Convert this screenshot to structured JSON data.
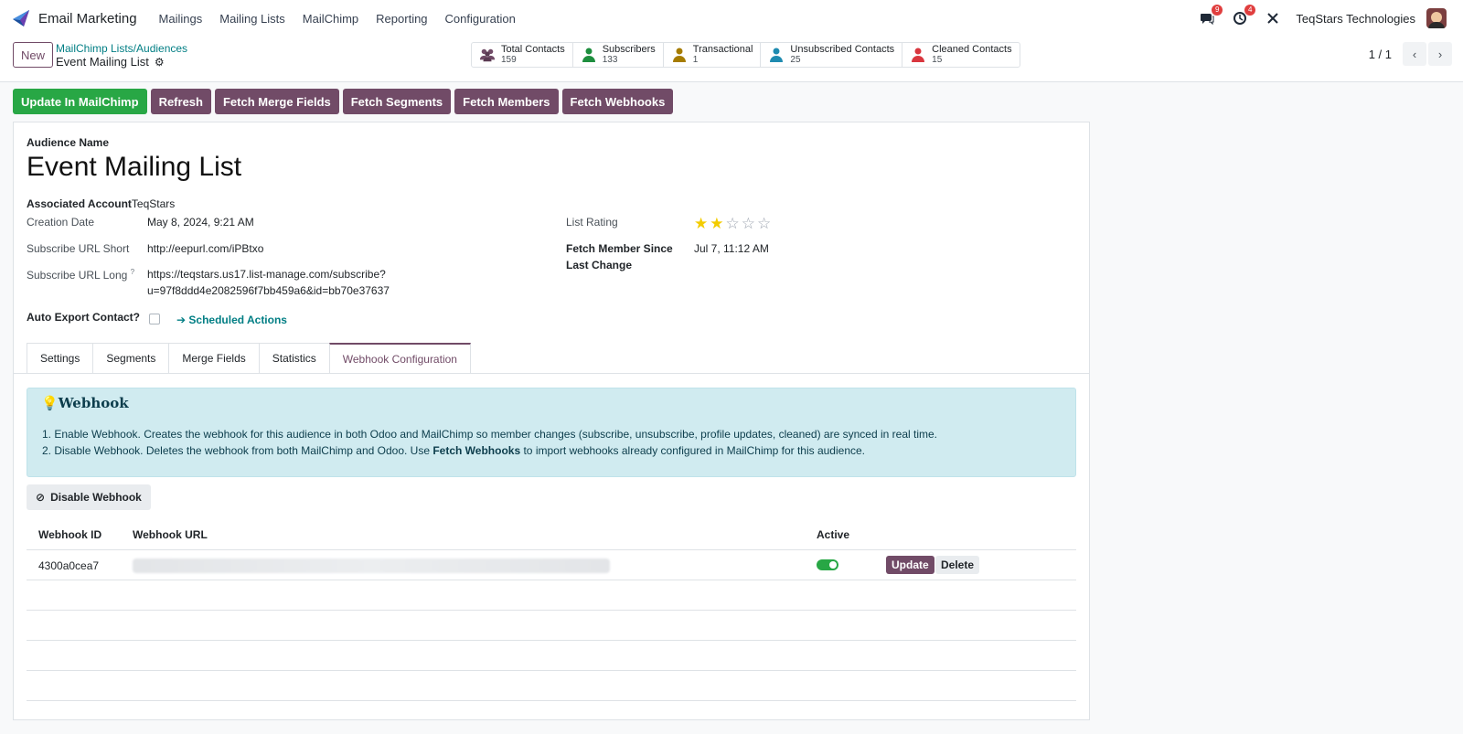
{
  "nav": {
    "app_name": "Email Marketing",
    "menu": [
      "Mailings",
      "Mailing Lists",
      "MailChimp",
      "Reporting",
      "Configuration"
    ],
    "messages_badge": "9",
    "activities_badge": "4",
    "company": "TeqStars Technologies"
  },
  "control": {
    "new_label": "New",
    "breadcrumb_parent": "MailChimp Lists/Audiences",
    "breadcrumb_current": "Event Mailing List",
    "stats": [
      {
        "label": "Total Contacts",
        "value": "159",
        "icon": "users-icon",
        "color": "#714b67"
      },
      {
        "label": "Subscribers",
        "value": "133",
        "icon": "user-icon",
        "color": "#1e8e3e"
      },
      {
        "label": "Transactional",
        "value": "1",
        "icon": "user-icon",
        "color": "#a67c00"
      },
      {
        "label": "Unsubscribed Contacts",
        "value": "25",
        "icon": "user-icon",
        "color": "#1f8bb0"
      },
      {
        "label": "Cleaned Contacts",
        "value": "15",
        "icon": "user-icon",
        "color": "#d9363e"
      }
    ],
    "pager": "1 / 1"
  },
  "actions": {
    "update": "Update In MailChimp",
    "refresh": "Refresh",
    "merge_fields": "Fetch Merge Fields",
    "segments": "Fetch Segments",
    "members": "Fetch Members",
    "webhooks": "Fetch Webhooks"
  },
  "form": {
    "audience_label": "Audience Name",
    "audience_name": "Event Mailing List",
    "assoc_label": "Associated Account",
    "assoc_value": "TeqStars",
    "creation_label": "Creation Date",
    "creation_value": "May 8, 2024, 9:21 AM",
    "url_short_label": "Subscribe URL Short",
    "url_short_value": "http://eepurl.com/iPBtxo",
    "url_long_label": "Subscribe URL Long",
    "url_long_value_1": "https://teqstars.us17.list-manage.com/subscribe?",
    "url_long_value_2": "u=97f8ddd4e2082596f7bb459a6&id=bb70e37637",
    "auto_export_label": "Auto Export Contact?",
    "scheduled_actions": "Scheduled Actions",
    "rating_label": "List Rating",
    "rating": 2,
    "rating_max": 5,
    "fetch_label_1": "Fetch Member Since",
    "fetch_label_2": "Last Change",
    "fetch_value": "Jul 7, 11:12 AM"
  },
  "tabs": [
    "Settings",
    "Segments",
    "Merge Fields",
    "Statistics",
    "Webhook Configuration"
  ],
  "webhook": {
    "title": "Webhook",
    "line1": "1. Enable Webhook. Creates the webhook for this audience in both Odoo and MailChimp so member changes (subscribe, unsubscribe, profile updates, cleaned) are synced in real time.",
    "line2_pre": "2. Disable Webhook. Deletes the webhook from both MailChimp and Odoo. Use ",
    "line2_bold": "Fetch Webhooks",
    "line2_post": " to import webhooks already configured in MailChimp for this audience.",
    "disable_label": "Disable Webhook",
    "col_id": "Webhook ID",
    "col_url": "Webhook URL",
    "col_active": "Active",
    "row_id": "4300a0cea7",
    "row_active": true,
    "update_label": "Update",
    "delete_label": "Delete"
  }
}
